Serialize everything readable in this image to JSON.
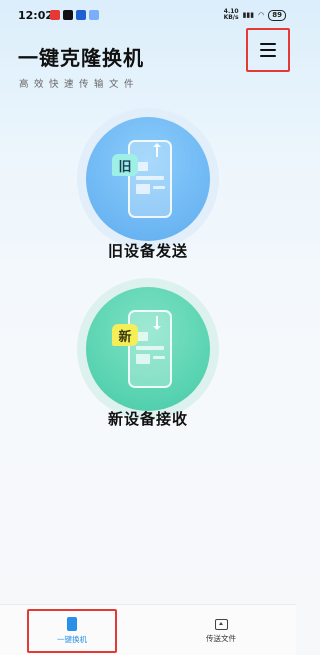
{
  "status_bar": {
    "time": "12:02",
    "net_speed_value": "4.10",
    "net_speed_unit": "KB/s",
    "battery": "89"
  },
  "header": {
    "title": "一键克隆换机",
    "subtitle": "高效快速传输文件"
  },
  "actions": {
    "old_device": {
      "badge": "旧",
      "label": "旧设备发送"
    },
    "new_device": {
      "badge": "新",
      "label": "新设备接收"
    }
  },
  "bottom_nav": {
    "items": [
      {
        "label": "一键换机",
        "active": true
      },
      {
        "label": "传送文件",
        "active": false
      }
    ]
  },
  "colors": {
    "accent": "#2a8fe6",
    "highlight_border": "#e53935",
    "old_circle": "#6cb6f3",
    "new_circle": "#57d2b0"
  }
}
